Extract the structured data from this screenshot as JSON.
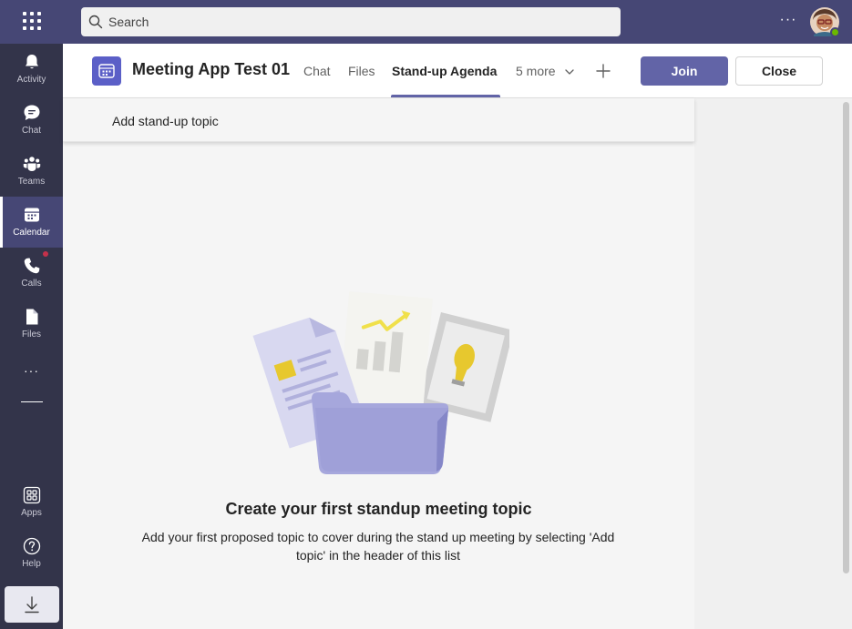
{
  "search": {
    "placeholder": "Search"
  },
  "topbar": {
    "more_label": "···",
    "avatar_icon": "user-avatar"
  },
  "rail": {
    "items": [
      {
        "label": "Activity",
        "icon": "bell-icon"
      },
      {
        "label": "Chat",
        "icon": "chat-icon"
      },
      {
        "label": "Teams",
        "icon": "teams-icon"
      },
      {
        "label": "Calendar",
        "icon": "calendar-icon",
        "active": true
      },
      {
        "label": "Calls",
        "icon": "phone-icon",
        "notification": true
      },
      {
        "label": "Files",
        "icon": "file-icon"
      },
      {
        "label": "Apps",
        "icon": "apps-icon"
      },
      {
        "label": "Help",
        "icon": "help-icon"
      }
    ],
    "more_label": "···"
  },
  "header": {
    "title": "Meeting App Test 01",
    "tabs": [
      {
        "label": "Chat"
      },
      {
        "label": "Files"
      },
      {
        "label": "Stand-up Agenda",
        "active": true
      }
    ],
    "more_tabs_label": "5 more",
    "join_label": "Join",
    "close_label": "Close"
  },
  "toolbar": {
    "add_topic_label": "Add stand-up topic"
  },
  "empty_state": {
    "title": "Create your first standup meeting topic",
    "description": "Add your first proposed topic to cover during the stand up meeting by selecting 'Add topic' in the header of this list"
  },
  "colors": {
    "topbar": "#464775",
    "rail": "#33344a",
    "accent": "#6264a7",
    "app_icon": "#5b5fc7"
  }
}
